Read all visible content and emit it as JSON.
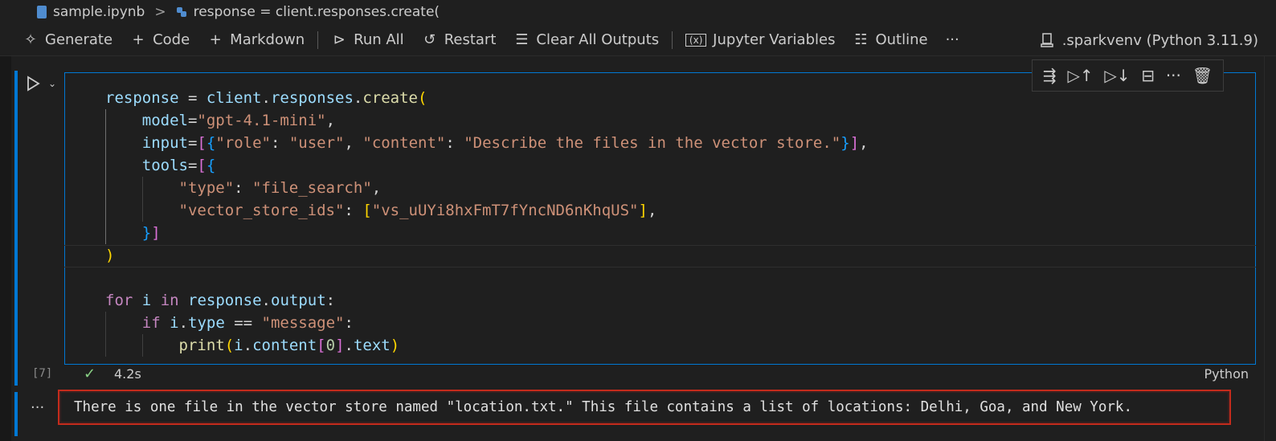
{
  "breadcrumb": {
    "file": "sample.ipynb",
    "separator": ">",
    "symbol": "response = client.responses.create("
  },
  "toolbar": {
    "generate": "Generate",
    "code": "Code",
    "markdown": "Markdown",
    "run_all": "Run All",
    "restart": "Restart",
    "clear_outputs": "Clear All Outputs",
    "variables": "Jupyter Variables",
    "outline": "Outline",
    "more": "···",
    "kernel": ".sparkvenv (Python 3.11.9)"
  },
  "cell": {
    "execution_count": "[7]",
    "duration": "4.2s",
    "language": "Python",
    "code": {
      "l1_var": "response",
      "l1_op": " = ",
      "l1_obj": "client",
      "l1_attr1": "responses",
      "l1_fn": "create",
      "l2_key": "model",
      "l2_val": "\"gpt-4.1-mini\"",
      "l3_key": "input",
      "l3_k1": "\"role\"",
      "l3_v1": "\"user\"",
      "l3_k2": "\"content\"",
      "l3_v2": "\"Describe the files in the vector store.\"",
      "l4_key": "tools",
      "l5_k": "\"type\"",
      "l5_v": "\"file_search\"",
      "l6_k": "\"vector_store_ids\"",
      "l6_v": "\"vs_uUYi8hxFmT7fYncND6nKhqUS\"",
      "l10_for": "for",
      "l10_i": "i",
      "l10_in": "in",
      "l10_obj": "response",
      "l10_attr": "output",
      "l11_if": "if",
      "l11_i": "i",
      "l11_attr": "type",
      "l11_op": " == ",
      "l11_str": "\"message\"",
      "l12_fn": "print",
      "l12_i": "i",
      "l12_attr": "content",
      "l12_idx": "0",
      "l12_attr2": "text"
    }
  },
  "output": {
    "text": "There is one file in the vector store named \"location.txt.\" This file contains a list of locations: Delhi, Goa, and New York."
  },
  "colors": {
    "accent": "#0078d4",
    "output_border": "#c42b1c",
    "success": "#89d185"
  }
}
